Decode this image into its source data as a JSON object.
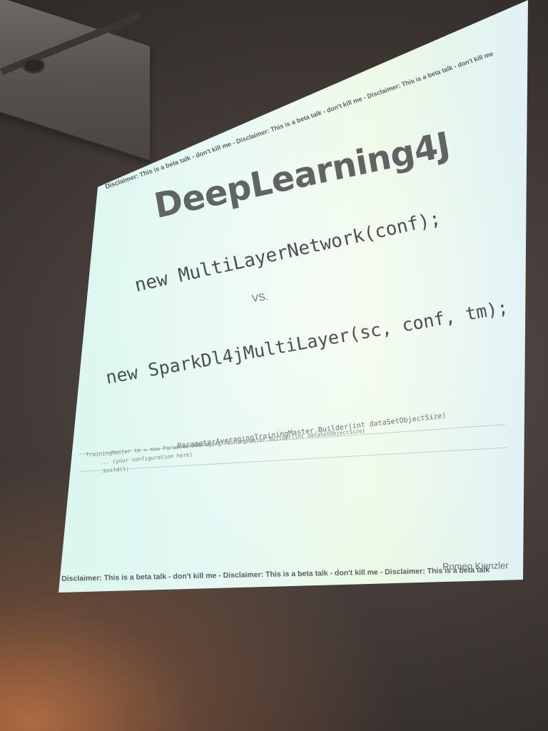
{
  "slide": {
    "disclaimer_top": "Disclaimer: This is a beta talk - don't kill me - Disclaimer: This is a beta talk - don't kill me - Disclaimer: This is a beta talk - don't kill me",
    "title": "DeepLearning4J",
    "code_line_1": "new MultiLayerNetwork(conf);",
    "vs": "VS.",
    "code_line_2": "new SparkDl4jMultiLayer(sc, conf, tm);",
    "builder_signature": "ParameterAveragingTrainingMaster.Builder(int dataSetObjectSize)",
    "snippet": [
      "TrainingMaster tm = new ParameterAveragingTrainingMaster.Builder(int dataSetObjectSize)",
      "    ... (your configuration here)",
      "    .build();"
    ],
    "disclaimer_bottom": "Disclaimer: This is a beta talk - don't kill me - Disclaimer: This is a beta talk - don't kill me - Disclaimer: This is a beta talk",
    "author": "Romeo Kienzler"
  },
  "colors": {
    "screen": "#e2f7f1",
    "room": "#3f3835",
    "warm_glow": "#c47646",
    "slide_text": "#4b4f4f"
  }
}
